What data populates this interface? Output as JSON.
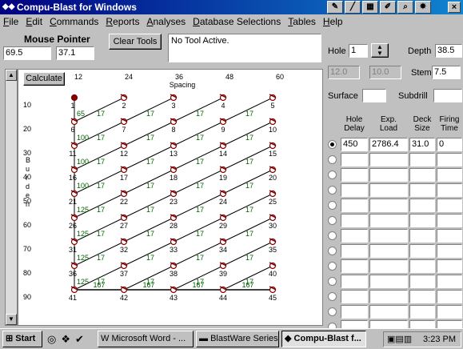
{
  "window": {
    "title": "Compu-Blast for Windows",
    "close": "×"
  },
  "menu": [
    "File",
    "Edit",
    "Commands",
    "Reports",
    "Analyses",
    "Database Selections",
    "Tables",
    "Help"
  ],
  "mouse_pointer": {
    "label": "Mouse Pointer",
    "x": "69.5",
    "y": "37.1"
  },
  "clear_tools": "Clear Tools",
  "status": "No Tool Active.",
  "calculate": "Calculate",
  "grid": {
    "x_ticks": [
      "12",
      "24",
      "36",
      "48",
      "60"
    ],
    "x_label": "Spacing",
    "y_ticks": [
      "10",
      "20",
      "30",
      "40",
      "50",
      "60",
      "70",
      "80",
      "90"
    ],
    "y_label": [
      "B",
      "u",
      "r",
      "d",
      "e",
      "n"
    ],
    "holes": [
      [
        "1",
        "2",
        "3",
        "4",
        "5"
      ],
      [
        "6",
        "7",
        "8",
        "9",
        "10"
      ],
      [
        "11",
        "12",
        "13",
        "14",
        "15"
      ],
      [
        "16",
        "17",
        "18",
        "19",
        "20"
      ],
      [
        "21",
        "22",
        "23",
        "24",
        "25"
      ],
      [
        "26",
        "27",
        "28",
        "29",
        "30"
      ],
      [
        "31",
        "32",
        "33",
        "34",
        "35"
      ],
      [
        "36",
        "37",
        "38",
        "39",
        "40"
      ],
      [
        "41",
        "42",
        "43",
        "44",
        "45"
      ]
    ],
    "row_delays": [
      "65",
      "100",
      "100",
      "100",
      "125",
      "125",
      "125",
      "125"
    ],
    "row_delay_label": "17",
    "bottom_delay": "167"
  },
  "panel": {
    "hole_label": "Hole",
    "hole_value": "1",
    "depth_label": "Depth",
    "depth_value": "38.5",
    "burden_value": "12.0",
    "spacing_value": "10.0",
    "stem_label": "Stem",
    "stem_value": "7.5",
    "surface_label": "Surface",
    "subdrill_label": "Subdrill",
    "col_headers": [
      [
        "Hole",
        "Delay"
      ],
      [
        "Exp.",
        "Load"
      ],
      [
        "Deck",
        "Size"
      ],
      [
        "Firing",
        "Time"
      ]
    ],
    "first_row": {
      "delay": "450",
      "load": "2786.4",
      "deck": "31.0",
      "time": "0"
    }
  },
  "taskbar": {
    "start": "Start",
    "tasks": [
      "Microsoft Word - ...",
      "BlastWare Series ...",
      "Compu-Blast f..."
    ],
    "clock": "3:23 PM"
  }
}
